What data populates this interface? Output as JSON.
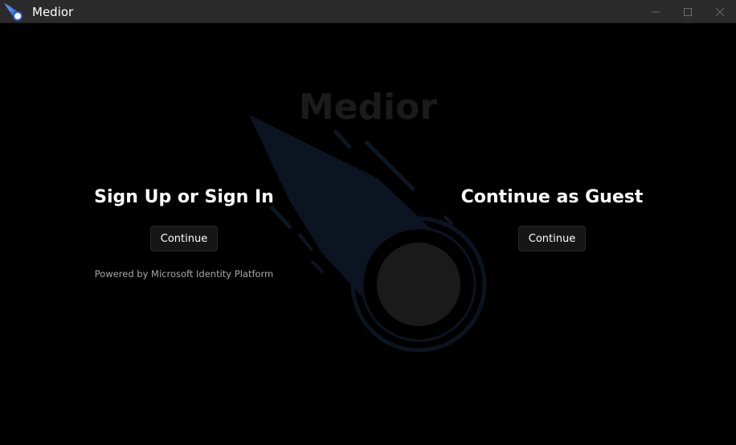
{
  "window": {
    "title": "Medior",
    "icon": "comet-icon",
    "controls": [
      "minimize-icon",
      "maximize-icon",
      "close-icon"
    ]
  },
  "background": {
    "logo_text": "Medior",
    "logo_icon": "comet-icon"
  },
  "sign_in_panel": {
    "heading": "Sign Up or Sign In",
    "button_label": "Continue",
    "footer": "Powered by Microsoft Identity Platform"
  },
  "guest_panel": {
    "heading": "Continue as Guest",
    "button_label": "Continue"
  },
  "colors": {
    "titlebar": "#2b2b2b",
    "background": "#000000",
    "comet": "#0b1420",
    "button": "#161616"
  }
}
